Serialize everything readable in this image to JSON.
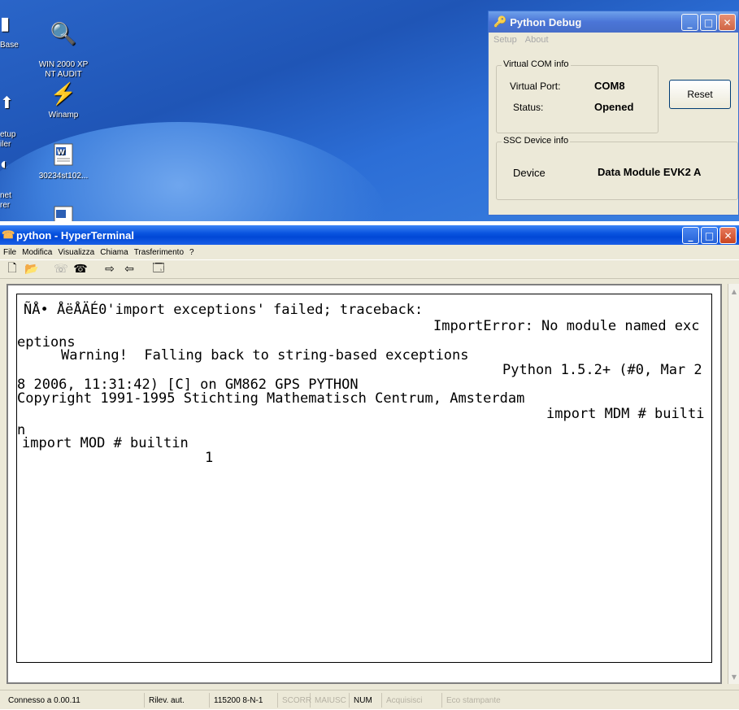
{
  "desktop": {
    "icons": [
      {
        "label": "Base",
        "icon": "database-icon"
      },
      {
        "label": "WIN 2000 XP\nNT AUDIT",
        "icon": "magnifier-icon"
      },
      {
        "label": "etup\niler",
        "icon": "setup-icon"
      },
      {
        "label": "Winamp",
        "icon": "winamp-icon"
      },
      {
        "label": "net\nrer",
        "icon": "internet-icon"
      },
      {
        "label": "30234st102...",
        "icon": "word-document-icon"
      }
    ]
  },
  "pydebug": {
    "title": "Python Debug",
    "menu": [
      "Setup",
      "About"
    ],
    "com_group": "Virtual COM info",
    "port_label": "Virtual Port:",
    "port_value": "COM8",
    "status_label": "Status:",
    "status_value": "Opened",
    "reset_label": "Reset",
    "device_group": "SSC Device info",
    "device_label": "Device",
    "device_value": "Data Module EVK2 A"
  },
  "hyperterminal": {
    "title": "python - HyperTerminal",
    "menu": [
      "File",
      "Modifica",
      "Visualizza",
      "Chiama",
      "Trasferimento",
      "?"
    ],
    "terminal_lines": [
      "ÑÅ• ÅëÅÄÉ0'import exceptions' failed; traceback:",
      "ImportError: No module named exc",
      "eptions",
      "Warning!  Falling back to string-based exceptions",
      "Python 1.5.2+ (#0, Mar 2",
      "8 2006, 11:31:42) [C] on GM862 GPS PYTHON",
      "Copyright 1991-1995 Stichting Mathematisch Centrum, Amsterdam",
      "import MDM # builti",
      "n",
      "import MOD # builtin",
      "1"
    ],
    "status": {
      "connected": "Connesso a 0.00.11",
      "detect": "Rilev. aut.",
      "settings": "115200 8-N-1",
      "scroll": "SCORR",
      "caps": "MAIUSC",
      "num": "NUM",
      "capture": "Acquisisci",
      "print": "Eco stampante"
    }
  }
}
